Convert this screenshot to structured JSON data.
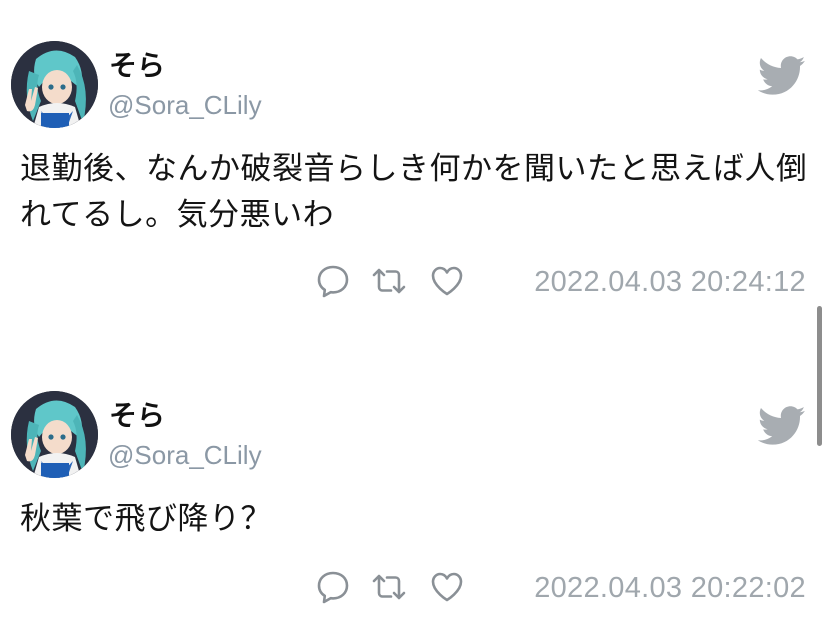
{
  "tweets": [
    {
      "display_name": "そら",
      "handle": "@Sora_CLily",
      "text": "退勤後、なんか破裂音らしき何かを聞いたと思えば人倒れてるし。気分悪いわ",
      "timestamp": "2022.04.03 20:24:12",
      "icons": {
        "reply": "reply-icon",
        "retweet": "retweet-icon",
        "like": "like-icon",
        "brand": "twitter-bird-icon"
      }
    },
    {
      "display_name": "そら",
      "handle": "@Sora_CLily",
      "text": "秋葉で飛び降り？",
      "timestamp": "2022.04.03 20:22:02",
      "icons": {
        "reply": "reply-icon",
        "retweet": "retweet-icon",
        "like": "like-icon",
        "brand": "twitter-bird-icon"
      }
    }
  ],
  "colors": {
    "handle": "#8b98a5",
    "timestamp": "#a0a7ad",
    "icon": "#8a9096",
    "bird": "#a8adb2",
    "text": "#141414"
  }
}
